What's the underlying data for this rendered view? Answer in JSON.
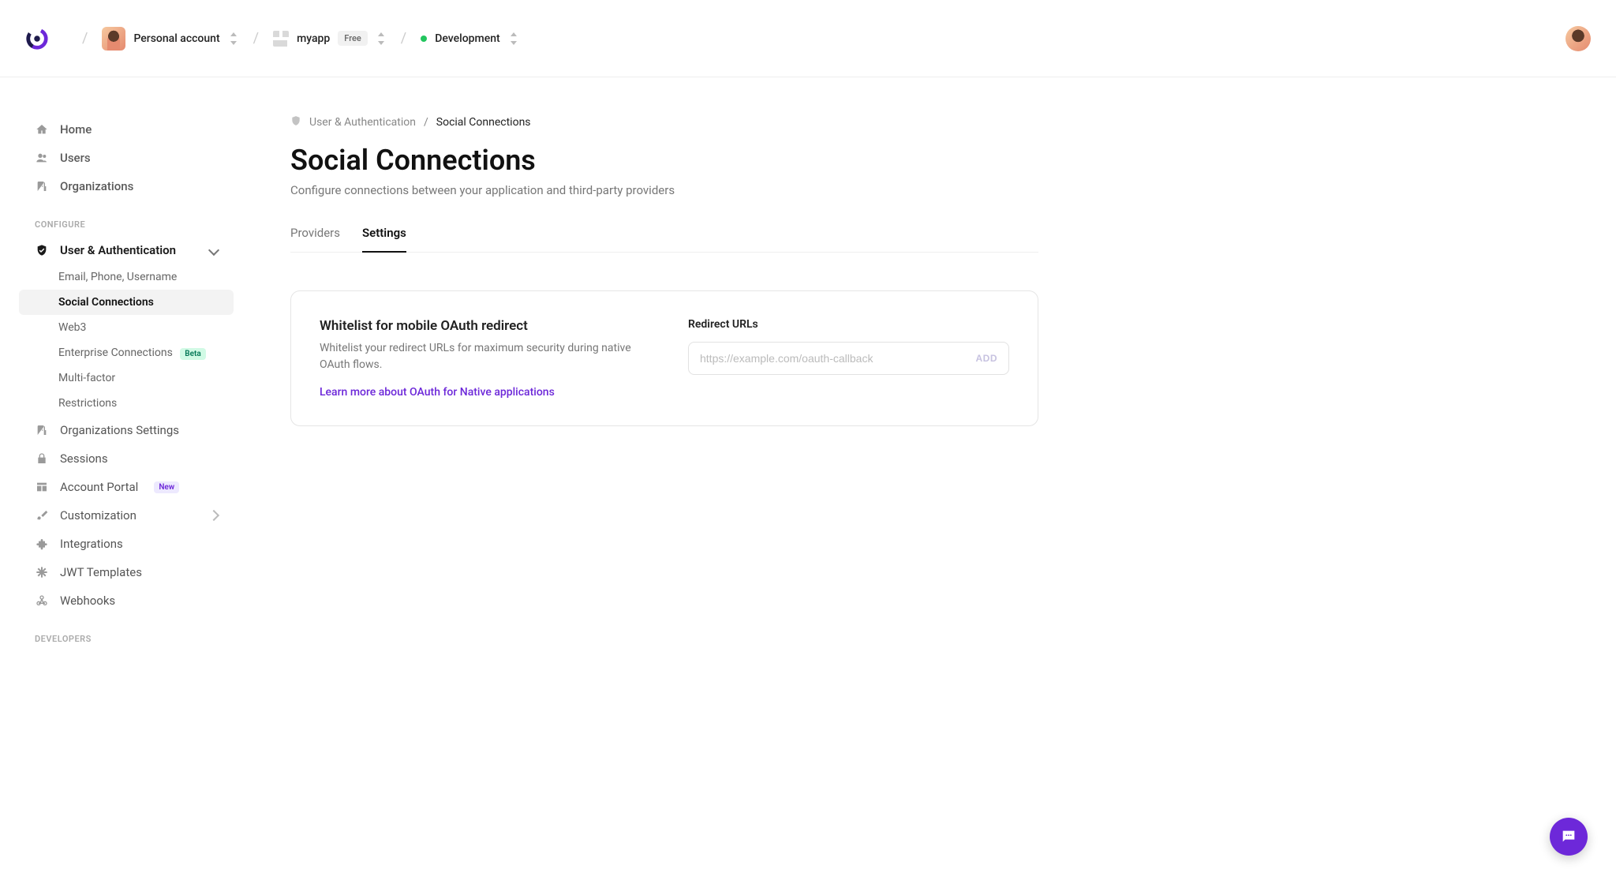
{
  "header": {
    "account_label": "Personal account",
    "app_label": "myapp",
    "app_badge": "Free",
    "env_label": "Development"
  },
  "sidebar": {
    "top": {
      "home": "Home",
      "users": "Users",
      "orgs": "Organizations"
    },
    "section_configure": "CONFIGURE",
    "user_auth": "User & Authentication",
    "sub": {
      "email": "Email, Phone, Username",
      "social": "Social Connections",
      "web3": "Web3",
      "enterprise": "Enterprise Connections",
      "enterprise_badge": "Beta",
      "mfa": "Multi-factor",
      "restrictions": "Restrictions"
    },
    "org_settings": "Organizations Settings",
    "sessions": "Sessions",
    "portal": "Account Portal",
    "portal_badge": "New",
    "customization": "Customization",
    "integrations": "Integrations",
    "jwt": "JWT Templates",
    "webhooks": "Webhooks",
    "section_dev": "DEVELOPERS"
  },
  "breadcrumb": {
    "parent": "User & Authentication",
    "current": "Social Connections"
  },
  "page": {
    "title": "Social Connections",
    "subtitle": "Configure connections between your application and third-party providers"
  },
  "tabs": {
    "providers": "Providers",
    "settings": "Settings"
  },
  "card": {
    "title": "Whitelist for mobile OAuth redirect",
    "desc": "Whitelist your redirect URLs for maximum security during native OAuth flows.",
    "link": "Learn more about OAuth for Native applications",
    "field_label": "Redirect URLs",
    "placeholder": "https://example.com/oauth-callback",
    "add": "ADD"
  }
}
